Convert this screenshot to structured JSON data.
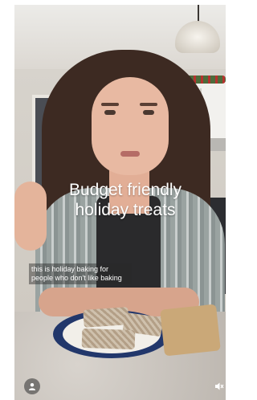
{
  "video": {
    "title_caption": "Budget friendly holiday treats",
    "subtitle": "this is holiday baking for people who don't like baking"
  },
  "controls": {
    "profile_icon": "person-icon",
    "sound_icon": "muted-speaker-icon"
  }
}
